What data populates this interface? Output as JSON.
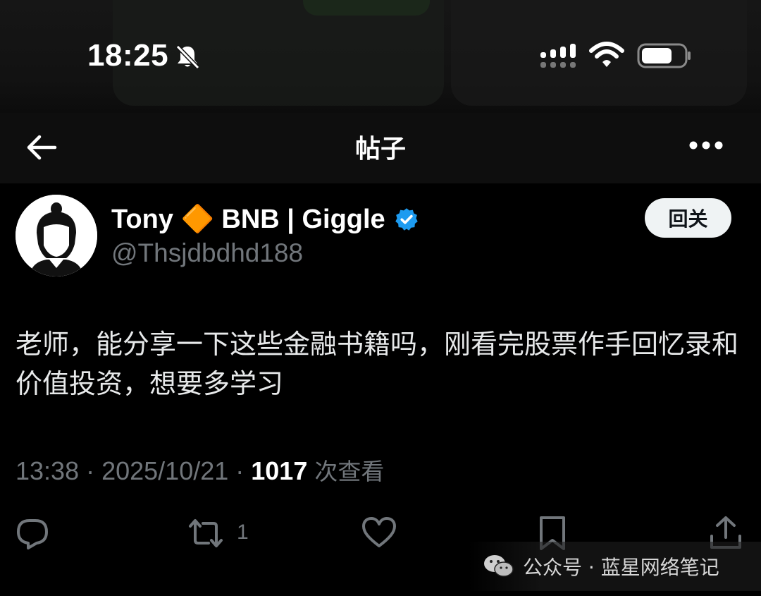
{
  "status_bar": {
    "time": "18:25"
  },
  "nav": {
    "title": "帖子"
  },
  "author": {
    "name": "Tony 🔶 BNB | Giggle",
    "handle": "@Thsjdbdhd188",
    "verified": true
  },
  "follow_button": {
    "label": "回关"
  },
  "tweet": {
    "text": "老师，能分享一下这些金融书籍吗，刚看完股票作手回忆录和价值投资，想要多学习"
  },
  "meta": {
    "time": "13:38 · 2025/10/21 · ",
    "views": "1017",
    "views_label": "次查看"
  },
  "actions": {
    "retweet_count": "1"
  },
  "watermark": {
    "text": "公众号 · 蓝星网络笔记"
  },
  "colors": {
    "background": "#000000",
    "text_primary": "#e7e9ea",
    "text_secondary": "#71767b",
    "verified_blue": "#1d9bf0",
    "diamond_orange": "#f7a31c"
  },
  "icons": [
    "bell-muted-icon",
    "signal-icon",
    "wifi-icon",
    "battery-icon",
    "back-arrow-icon",
    "more-icon",
    "verified-badge-icon",
    "reply-icon",
    "retweet-icon",
    "like-icon",
    "bookmark-icon",
    "share-icon",
    "wechat-icon"
  ]
}
